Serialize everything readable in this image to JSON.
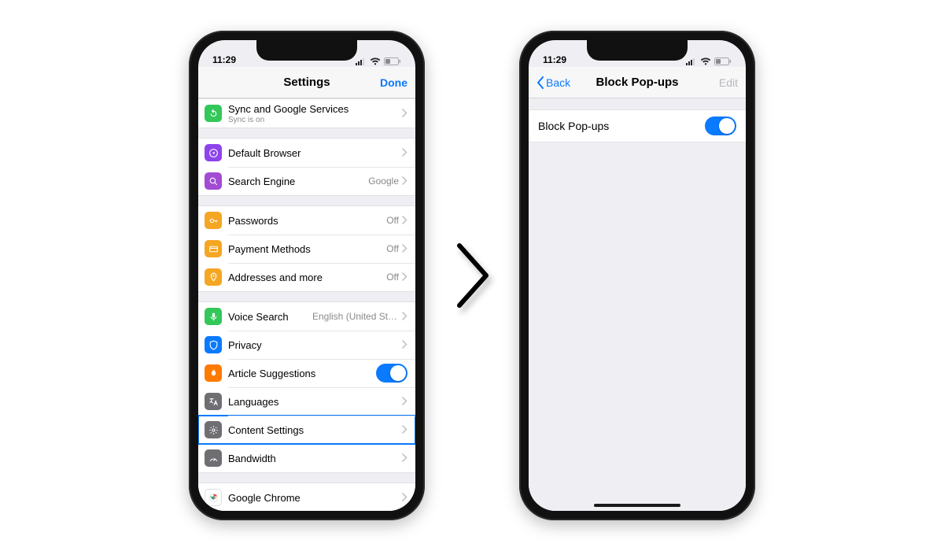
{
  "status": {
    "time": "11:29"
  },
  "screen1": {
    "navbar": {
      "title": "Settings",
      "right": "Done"
    },
    "groups": [
      [
        {
          "icon": "sync-icon",
          "iconColor": "#34c759",
          "label": "Sync and Google Services",
          "sub": "Sync is on",
          "value": "",
          "type": "chev"
        }
      ],
      [
        {
          "icon": "compass-icon",
          "iconColor": "#8e44ec",
          "label": "Default Browser",
          "value": "",
          "type": "chev"
        },
        {
          "icon": "search-icon",
          "iconColor": "#a24bd3",
          "label": "Search Engine",
          "value": "Google",
          "type": "chev"
        }
      ],
      [
        {
          "icon": "key-icon",
          "iconColor": "#f5a623",
          "label": "Passwords",
          "value": "Off",
          "type": "chev"
        },
        {
          "icon": "card-icon",
          "iconColor": "#f5a623",
          "label": "Payment Methods",
          "value": "Off",
          "type": "chev"
        },
        {
          "icon": "pin-icon",
          "iconColor": "#f5a623",
          "label": "Addresses and more",
          "value": "Off",
          "type": "chev"
        }
      ],
      [
        {
          "icon": "mic-icon",
          "iconColor": "#34c759",
          "label": "Voice Search",
          "value": "English (United Sta...",
          "type": "chev"
        },
        {
          "icon": "shield-icon",
          "iconColor": "#0a7aff",
          "label": "Privacy",
          "value": "",
          "type": "chev"
        },
        {
          "icon": "flame-icon",
          "iconColor": "#ff7a00",
          "label": "Article Suggestions",
          "value": "",
          "type": "toggle"
        },
        {
          "icon": "translate-icon",
          "iconColor": "#6e6e73",
          "label": "Languages",
          "value": "",
          "type": "chev"
        },
        {
          "icon": "gear-icon",
          "iconColor": "#6e6e73",
          "label": "Content Settings",
          "value": "",
          "type": "chev",
          "highlight": true
        },
        {
          "icon": "gauge-icon",
          "iconColor": "#6e6e73",
          "label": "Bandwidth",
          "value": "",
          "type": "chev"
        }
      ],
      [
        {
          "icon": "chrome-icon",
          "iconColor": "#ffffff",
          "label": "Google Chrome",
          "value": "",
          "type": "chev"
        }
      ]
    ]
  },
  "screen2": {
    "navbar": {
      "back": "Back",
      "title": "Block Pop-ups",
      "right": "Edit"
    },
    "row_label": "Block Pop-ups"
  }
}
